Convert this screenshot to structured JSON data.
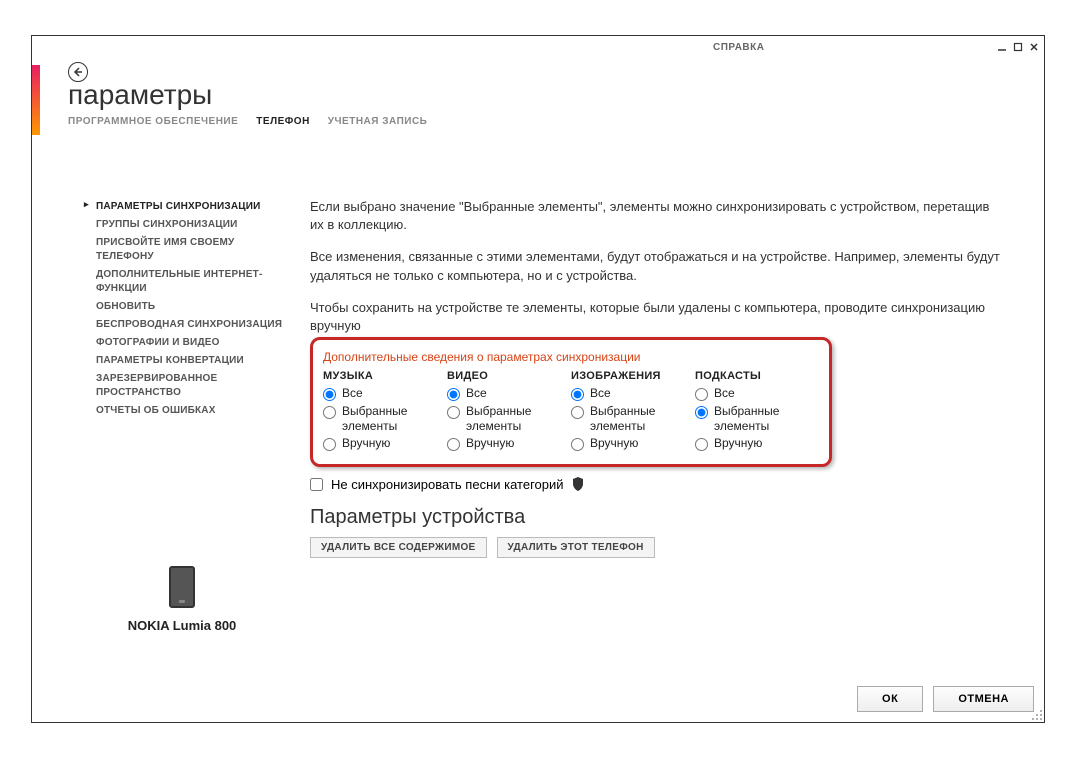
{
  "help": "СПРАВКА",
  "page_title": "параметры",
  "tabs": [
    {
      "label": "ПРОГРАММНОЕ ОБЕСПЕЧЕНИЕ",
      "active": false
    },
    {
      "label": "ТЕЛЕФОН",
      "active": true
    },
    {
      "label": "УЧЕТНАЯ ЗАПИСЬ",
      "active": false
    }
  ],
  "sidebar": [
    {
      "label": "ПАРАМЕТРЫ СИНХРОНИЗАЦИИ",
      "active": true
    },
    {
      "label": "ГРУППЫ СИНХРОНИЗАЦИИ",
      "active": false
    },
    {
      "label": "ПРИСВОЙТЕ ИМЯ СВОЕМУ ТЕЛЕФОНУ",
      "active": false
    },
    {
      "label": "ДОПОЛНИТЕЛЬНЫЕ ИНТЕРНЕТ-ФУНКЦИИ",
      "active": false
    },
    {
      "label": "ОБНОВИТЬ",
      "active": false
    },
    {
      "label": "БЕСПРОВОДНАЯ СИНХРОНИЗАЦИЯ",
      "active": false
    },
    {
      "label": "ФОТОГРАФИИ И ВИДЕО",
      "active": false
    },
    {
      "label": "ПАРАМЕТРЫ КОНВЕРТАЦИИ",
      "active": false
    },
    {
      "label": "ЗАРЕЗЕРВИРОВАННОЕ ПРОСТРАНСТВО",
      "active": false
    },
    {
      "label": "ОТЧЕТЫ ОБ ОШИБКАХ",
      "active": false
    }
  ],
  "device_name": "NOKIA Lumia 800",
  "content": {
    "p1": "Если выбрано значение \"Выбранные элементы\", элементы можно синхронизировать с устройством, перетащив их в коллекцию.",
    "p2": "Все изменения, связанные с этими элементами, будут отображаться и на устройстве. Например, элементы будут удаляться не только с компьютера, но и с устройства.",
    "p3": "Чтобы сохранить на устройстве те элементы, которые были удалены с компьютера, проводите синхронизацию вручную",
    "sync_info_link": "Дополнительные сведения о параметрах синхронизации",
    "categories": [
      {
        "name": "МУЗЫКА",
        "options": [
          "Все",
          "Выбранные элементы",
          "Вручную"
        ],
        "selected": 0
      },
      {
        "name": "ВИДЕО",
        "options": [
          "Все",
          "Выбранные элементы",
          "Вручную"
        ],
        "selected": 0
      },
      {
        "name": "ИЗОБРАЖЕНИЯ",
        "options": [
          "Все",
          "Выбранные элементы",
          "Вручную"
        ],
        "selected": 0
      },
      {
        "name": "ПОДКАСТЫ",
        "options": [
          "Все",
          "Выбранные элементы",
          "Вручную"
        ],
        "selected": 1
      }
    ],
    "checkbox_label": "Не синхронизировать песни категорий",
    "checkbox_checked": false,
    "device_params_head": "Параметры устройства",
    "delete_content_btn": "УДАЛИТЬ ВСЕ СОДЕРЖИМОЕ",
    "delete_phone_btn": "УДАЛИТЬ ЭТОТ ТЕЛЕФОН"
  },
  "footer": {
    "ok": "ОК",
    "cancel": "ОТМЕНА"
  }
}
